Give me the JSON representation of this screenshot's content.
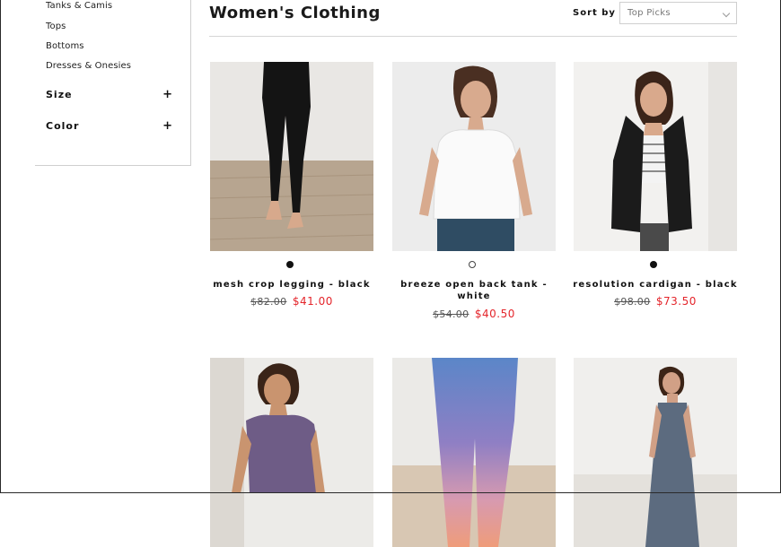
{
  "sidebar": {
    "categories": [
      "Tanks & Camis",
      "Tops",
      "Bottoms",
      "Dresses & Onesies"
    ],
    "filters": [
      {
        "label": "Size",
        "toggle": "+"
      },
      {
        "label": "Color",
        "toggle": "+"
      }
    ]
  },
  "header": {
    "title": "Women's Clothing",
    "sort_label": "Sort by",
    "sort_value": "Top Picks"
  },
  "products": [
    {
      "name": "mesh crop legging - black",
      "old_price": "$82.00",
      "sale_price": "$41.00",
      "swatch": "#111111"
    },
    {
      "name": "breeze open back tank - white",
      "old_price": "$54.00",
      "sale_price": "$40.50",
      "swatch": "#ffffff"
    },
    {
      "name": "resolution cardigan - black",
      "old_price": "$98.00",
      "sale_price": "$73.50",
      "swatch": "#111111"
    },
    {
      "name": "",
      "old_price": "",
      "sale_price": ""
    },
    {
      "name": "",
      "old_price": "",
      "sale_price": ""
    },
    {
      "name": "",
      "old_price": "",
      "sale_price": ""
    }
  ],
  "colors": {
    "sale": "#e4252b",
    "border": "#cfcfcf"
  }
}
